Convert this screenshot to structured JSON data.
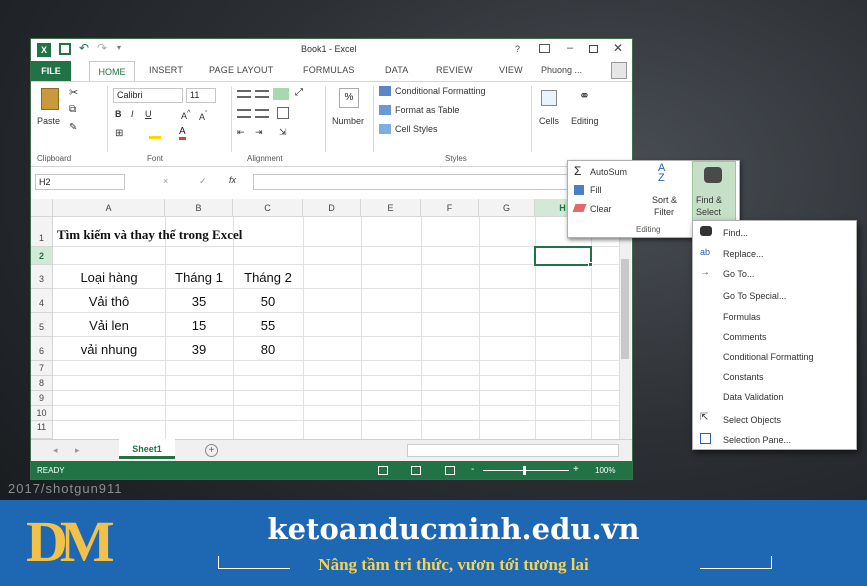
{
  "window": {
    "title": "Book1 - Excel",
    "help": "?",
    "account": "Phuong ..."
  },
  "tabs": [
    "FILE",
    "HOME",
    "INSERT",
    "PAGE LAYOUT",
    "FORMULAS",
    "DATA",
    "REVIEW",
    "VIEW"
  ],
  "ribbon": {
    "paste": "Paste",
    "font_name": "Calibri",
    "font_size": "11",
    "number_label": "Number",
    "percent": "%",
    "conditional_formatting": "Conditional Formatting",
    "format_as_table": "Format as Table",
    "cell_styles": "Cell Styles",
    "cells": "Cells",
    "editing": "Editing",
    "groups": {
      "clipboard": "Clipboard",
      "font": "Font",
      "alignment": "Alignment",
      "styles": "Styles"
    }
  },
  "formula_bar": {
    "name_box": "H2",
    "fx": "fx",
    "cancel": "×",
    "enter": "✓",
    "value": ""
  },
  "columns": [
    "A",
    "B",
    "C",
    "D",
    "E",
    "F",
    "G",
    "H"
  ],
  "rows": [
    "1",
    "2",
    "3",
    "4",
    "5",
    "6",
    "7",
    "8",
    "9",
    "10",
    "11"
  ],
  "sheet": {
    "title": "Tìm kiếm và thay thế trong Excel",
    "headers": [
      "Loại hàng",
      "Tháng 1",
      "Tháng 2"
    ],
    "data": [
      [
        "Vải thô",
        "35",
        "50"
      ],
      [
        "Vải len",
        "15",
        "55"
      ],
      [
        "vải nhung",
        "39",
        "80"
      ]
    ]
  },
  "sheet_tab": "Sheet1",
  "add_sheet": "+",
  "status": {
    "ready": "READY",
    "zoom": "100%",
    "minus": "-",
    "plus": "+"
  },
  "editing_popup": {
    "autosum": "AutoSum",
    "fill": "Fill",
    "clear": "Clear",
    "sort_filter_1": "Sort &",
    "sort_filter_2": "Filter",
    "find_select_1": "Find &",
    "find_select_2": "Select",
    "group": "Editing"
  },
  "find_menu": [
    {
      "label": "Find...",
      "icon": "binoculars-icon"
    },
    {
      "label": "Replace...",
      "icon": "replace-icon"
    },
    {
      "label": "Go To...",
      "icon": "arrow-right-icon"
    },
    {
      "label": "Go To Special...",
      "icon": ""
    },
    {
      "label": "Formulas",
      "icon": ""
    },
    {
      "label": "Comments",
      "icon": ""
    },
    {
      "label": "Conditional Formatting",
      "icon": ""
    },
    {
      "label": "Constants",
      "icon": ""
    },
    {
      "label": "Data Validation",
      "icon": ""
    },
    {
      "label": "Select Objects",
      "icon": "cursor-icon"
    },
    {
      "label": "Selection Pane...",
      "icon": "selection-pane-icon"
    }
  ],
  "watermark": "2017/shotgun911",
  "footer": {
    "logo": "DM",
    "site": "ketoanducminh.edu.vn",
    "slogan": "Nâng tầm tri thức, vươn tới tương lai"
  },
  "colors": {
    "excel_green": "#217346",
    "footer_blue": "#1e67b3",
    "logo_gold": "#f2c14a",
    "slogan_yellow": "#f2d35a"
  }
}
